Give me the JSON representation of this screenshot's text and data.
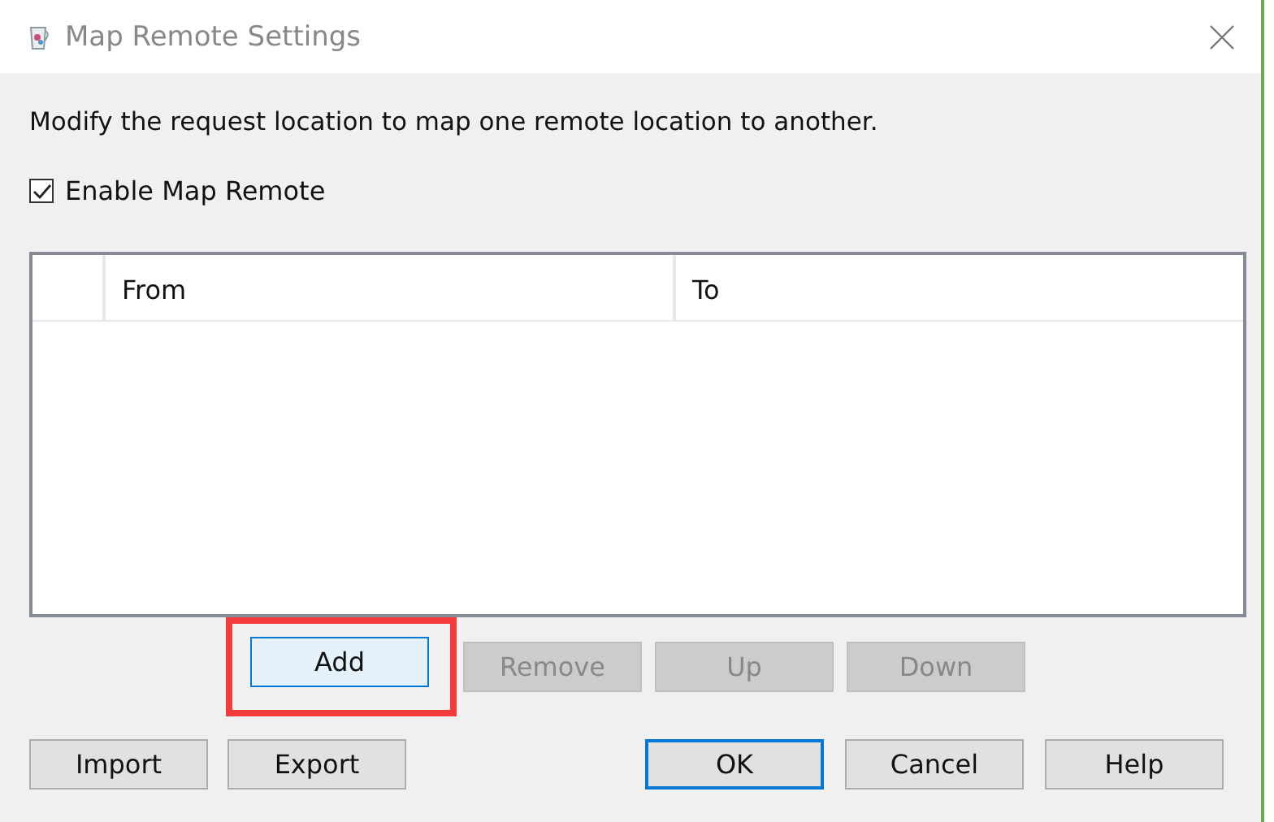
{
  "window": {
    "title": "Map Remote Settings"
  },
  "description": "Modify the request location to map one remote location to another.",
  "enable_checkbox": {
    "label": "Enable Map Remote",
    "checked": true
  },
  "table": {
    "columns": [
      "From",
      "To"
    ]
  },
  "row_buttons": [
    {
      "label": "Add",
      "focused": true,
      "disabled": false,
      "highlighted": true
    },
    {
      "label": "Remove",
      "focused": false,
      "disabled": true,
      "highlighted": false
    },
    {
      "label": "Up",
      "focused": false,
      "disabled": true,
      "highlighted": false
    },
    {
      "label": "Down",
      "focused": false,
      "disabled": true,
      "highlighted": false
    }
  ],
  "left_buttons": [
    {
      "label": "Import",
      "default": false
    },
    {
      "label": "Export",
      "default": false
    }
  ],
  "right_buttons": [
    {
      "label": "OK",
      "default": true
    },
    {
      "label": "Cancel",
      "default": false
    },
    {
      "label": "Help",
      "default": false
    }
  ]
}
